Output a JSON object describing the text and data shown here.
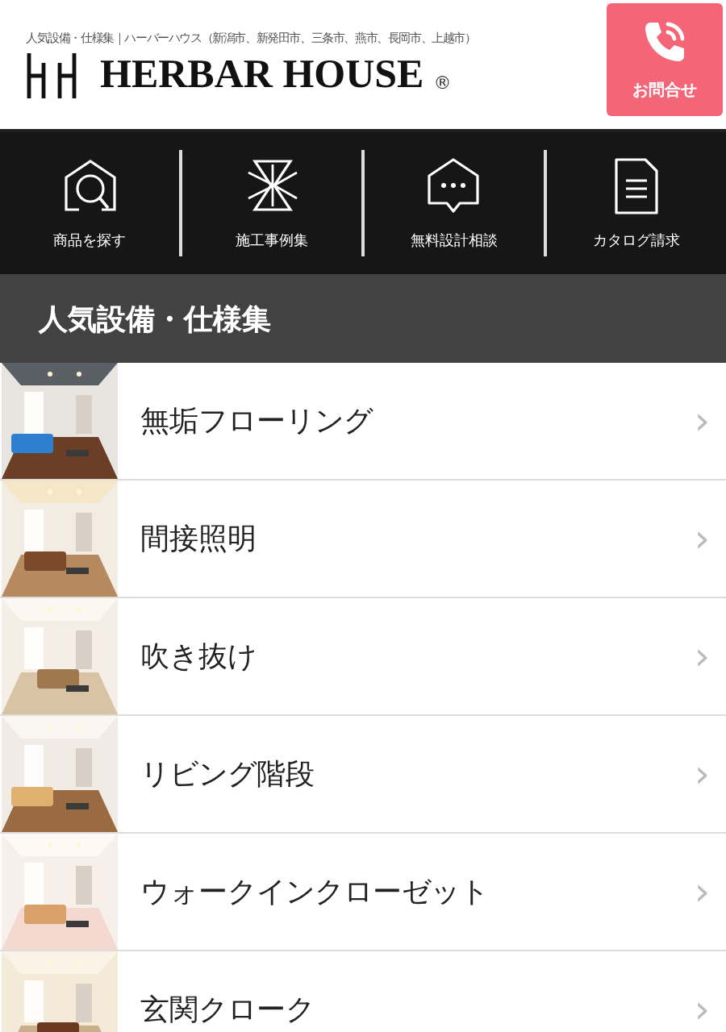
{
  "header": {
    "tagline": "人気設備・仕様集｜ハーバーハウス（新潟市、新発田市、三条市、燕市、長岡市、上越市）",
    "logo": "HERBAR HOUSE",
    "registered": "®",
    "contact_button": "お問合せ"
  },
  "nav": [
    {
      "label": "商品を探す",
      "kind": "search"
    },
    {
      "label": "施工事例集",
      "kind": "cases"
    },
    {
      "label": "無料設計相談",
      "kind": "chat"
    },
    {
      "label": "カタログ請求",
      "kind": "catalog"
    }
  ],
  "section_title": "人気設備・仕様集",
  "items": [
    {
      "label": "無垢フローリング",
      "arrow": "›",
      "kind": "picture"
    },
    {
      "label": "間接照明",
      "arrow": "›",
      "kind": "picture"
    },
    {
      "label": "吹き抜け",
      "arrow": "›",
      "kind": "picture"
    },
    {
      "label": "リビング階段",
      "arrow": "›",
      "kind": "picture"
    },
    {
      "label": "ウォークインクローゼット",
      "arrow": "›",
      "kind": "picture"
    },
    {
      "label": "玄関クローク",
      "arrow": "›",
      "kind": "picture"
    }
  ]
}
